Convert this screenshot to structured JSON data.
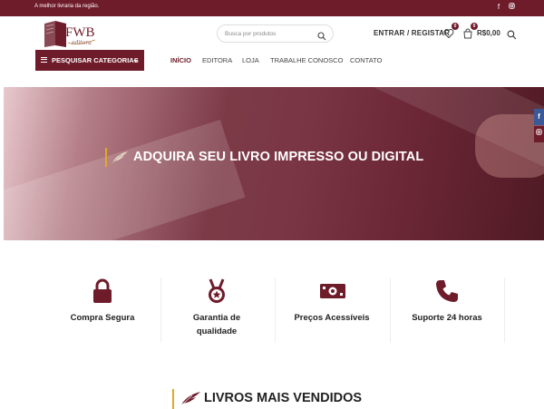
{
  "topbar": {
    "tagline": "A melhor livraria da região.",
    "social_icons": [
      "facebook-icon",
      "instagram-icon"
    ]
  },
  "header": {
    "logo_text": "FWB",
    "logo_subtext": "editora",
    "search_placeholder": "Busca por produtos",
    "account_label": "ENTRAR / REGISTAR",
    "wishlist_count": "0",
    "cart_count": "0",
    "cart_total": "R$0,00"
  },
  "nav": {
    "categories_label": "PESQUISAR CATEGORIAS",
    "items": [
      {
        "label": "INÍCIO",
        "active": true
      },
      {
        "label": "EDITORA",
        "active": false
      },
      {
        "label": "LOJA",
        "active": false
      },
      {
        "label": "TRABALHE CONOSCO",
        "active": false
      },
      {
        "label": "CONTATO",
        "active": false
      }
    ]
  },
  "hero": {
    "title": "ADQUIRA SEU LIVRO IMPRESSO OU DIGITAL"
  },
  "features": [
    {
      "icon": "lock-icon",
      "label": "Compra Segura"
    },
    {
      "icon": "medal-icon",
      "label": "Garantia de qualidade"
    },
    {
      "icon": "money-icon",
      "label": "Preços Acessíveis"
    },
    {
      "icon": "phone-icon",
      "label": "Suporte 24 horas"
    }
  ],
  "section": {
    "title": "LIVROS MAIS VENDIDOS"
  },
  "colors": {
    "brand": "#6e1b2a",
    "accent": "#e0a92b"
  }
}
